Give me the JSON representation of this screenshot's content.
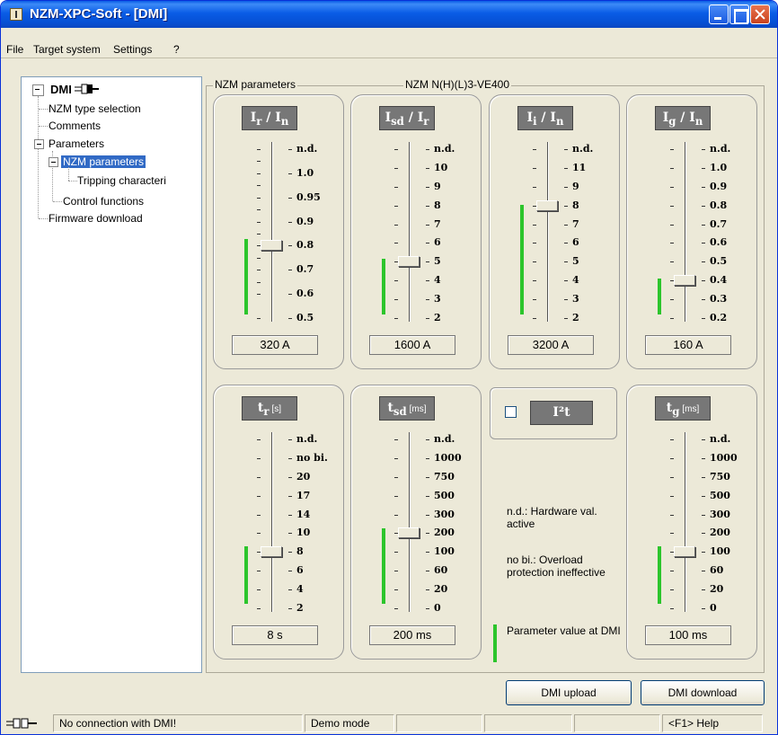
{
  "window": {
    "title": "NZM-XPC-Soft - [DMI]"
  },
  "menu": [
    "File",
    "Target system",
    "Settings",
    "?"
  ],
  "tree": {
    "root": "DMI",
    "items": [
      {
        "label": "NZM type selection"
      },
      {
        "label": "Comments"
      },
      {
        "label": "Parameters"
      },
      {
        "label": "NZM parameters"
      },
      {
        "label": "Tripping characteri"
      },
      {
        "label": "Control functions"
      },
      {
        "label": "Firmware download"
      }
    ]
  },
  "groups": {
    "left": "NZM parameters",
    "right": "NZM N(H)(L)3-VE400"
  },
  "panels": [
    {
      "head_main": "I",
      "head_sub": "r",
      "head_tail": " / I",
      "head_tail_sub": "n",
      "labels": [
        "n.d.",
        "1.0",
        "0.95",
        "0.9",
        "0.8",
        "0.7",
        "0.6",
        "0.5"
      ],
      "selected_index": 4,
      "value": "320 A"
    },
    {
      "head_main": "I",
      "head_sub": "sd",
      "head_tail": " / I",
      "head_tail_sub": "r",
      "labels": [
        "n.d.",
        "10",
        "9",
        "8",
        "7",
        "6",
        "5",
        "4",
        "3",
        "2"
      ],
      "selected_index": 6,
      "value": "1600 A"
    },
    {
      "head_main": "I",
      "head_sub": "i",
      "head_tail": " / I",
      "head_tail_sub": "n",
      "labels": [
        "n.d.",
        "11",
        "9",
        "8",
        "7",
        "6",
        "5",
        "4",
        "3",
        "2"
      ],
      "selected_index": 3,
      "value": "3200 A"
    },
    {
      "head_main": "I",
      "head_sub": "g",
      "head_tail": " / I",
      "head_tail_sub": "n",
      "labels": [
        "n.d.",
        "1.0",
        "0.9",
        "0.8",
        "0.7",
        "0.6",
        "0.5",
        "0.4",
        "0.3",
        "0.2"
      ],
      "selected_index": 7,
      "value": "160 A"
    },
    {
      "head_main": "t",
      "head_sub": "r",
      "head_tail": "",
      "head_unit": "[s]",
      "labels": [
        "n.d.",
        "no bi.",
        "20",
        "17",
        "14",
        "10",
        "8",
        "6",
        "4",
        "2"
      ],
      "selected_index": 6,
      "value": "8 s"
    },
    {
      "head_main": "t",
      "head_sub": "sd",
      "head_tail": "",
      "head_unit": "[ms]",
      "labels": [
        "n.d.",
        "1000",
        "750",
        "500",
        "300",
        "200",
        "100",
        "60",
        "20",
        "0"
      ],
      "selected_index": 5,
      "value": "200 ms"
    },
    {
      "head_main": "t",
      "head_sub": "g",
      "head_tail": "",
      "head_unit": "[ms]",
      "labels": [
        "n.d.",
        "1000",
        "750",
        "500",
        "300",
        "200",
        "100",
        "60",
        "20",
        "0"
      ],
      "selected_index": 6,
      "value": "100 ms"
    }
  ],
  "i2t": {
    "label": "I²t",
    "checked": false
  },
  "notes": {
    "nd": "n.d.: Hardware val. active",
    "nobi": "no bi.: Overload protection ineffective",
    "legend": "Parameter value at DMI"
  },
  "buttons": {
    "upload": "DMI upload",
    "download": "DMI download"
  },
  "status": {
    "connection": "No connection with DMI!",
    "mode": "Demo mode",
    "help": "<F1> Help"
  },
  "colors": {
    "title_blue": "#0a5ce6",
    "green_bar": "#2cc52c",
    "selection": "#316ac5"
  }
}
